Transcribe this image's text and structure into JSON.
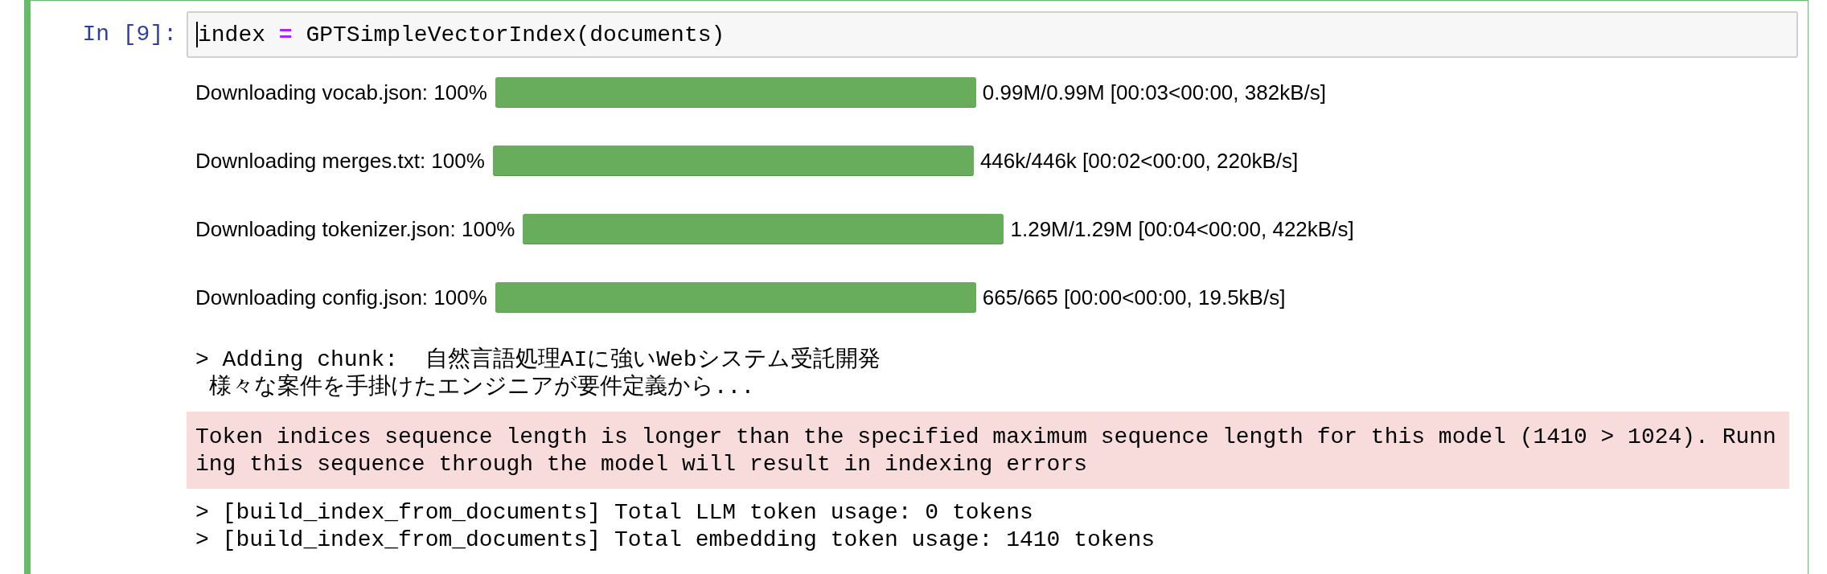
{
  "cell": {
    "prompt": "In [9]:",
    "editing": true,
    "code": [
      {
        "kind": "name",
        "text": "index "
      },
      {
        "kind": "operator",
        "text": "="
      },
      {
        "kind": "name",
        "text": " GPTSimpleVectorIndex(documents)"
      }
    ],
    "outputs": [
      {
        "kind": "progress",
        "label": "Downloading vocab.json: 100%",
        "level": 1,
        "stats": "0.99M/0.99M [00:03<00:00, 382kB/s]"
      },
      {
        "kind": "progress",
        "label": "Downloading merges.txt: 100%",
        "level": 1,
        "stats": "446k/446k [00:02<00:00, 220kB/s]"
      },
      {
        "kind": "progress",
        "label": "Downloading tokenizer.json: 100%",
        "level": 1,
        "stats": "1.29M/1.29M [00:04<00:00, 422kB/s]"
      },
      {
        "kind": "progress",
        "label": "Downloading config.json: 100%",
        "level": 1,
        "stats": "665/665 [00:00<00:00, 19.5kB/s]"
      },
      {
        "kind": "stdout",
        "lines": [
          "> Adding chunk:  自然言語処理AIに強いWebシステム受託開発",
          " 様々な案件を手掛けたエンジニアが要件定義から..."
        ]
      },
      {
        "kind": "stderr",
        "lines": [
          "Token indices sequence length is longer than the specified maximum sequence length for this model (1410 > 1024). Runn",
          "ing this sequence through the model will result in indexing errors"
        ]
      },
      {
        "kind": "stdout",
        "lines": [
          "> [build_index_from_documents] Total LLM token usage: 0 tokens",
          "> [build_index_from_documents] Total embedding token usage: 1410 tokens"
        ]
      }
    ]
  }
}
